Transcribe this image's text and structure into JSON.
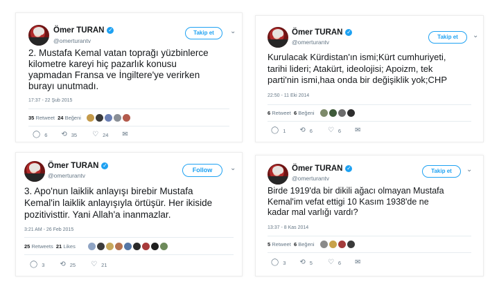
{
  "tweets": [
    {
      "name": "Ömer TURAN",
      "handle": "@omerturantv",
      "follow_label": "Takip et",
      "text_lines": [
        "2. Mustafa Kemal vatan toprağı yüzbinlerce",
        "kilometre kareyi hiç pazarlık konusu",
        "yapmadan Fransa ve İngiltere'ye verirken",
        "burayı unutmadı."
      ],
      "timestamp": "17:37 - 22 Şub 2015",
      "retweets_count": "35",
      "retweets_label": "Retweet",
      "likes_count": "24",
      "likes_label": "Beğeni",
      "replies": "6",
      "retweets_action": "35",
      "likes_action": "24"
    },
    {
      "name": "Ömer TURAN",
      "handle": "@omerturantv",
      "follow_label": "Takip et",
      "text_lines": [
        "Kurulacak Kürdistan'ın ismi;Kürt cumhuriyeti,",
        "tarihi lideri; Atakürt, ideolojisi; Apoizm, tek",
        "parti'nin ismi,haa onda bir değişiklik yok;CHP"
      ],
      "timestamp": "22:50 - 11 Eki 2014",
      "retweets_count": "6",
      "retweets_label": "Retweet",
      "likes_count": "6",
      "likes_label": "Beğeni",
      "replies": "1",
      "retweets_action": "6",
      "likes_action": "6"
    },
    {
      "name": "Ömer TURAN",
      "handle": "@omerturantv",
      "follow_label": "Follow",
      "text_lines": [
        "3. Apo'nun laiklik anlayışı birebir Mustafa",
        "Kemal'in laiklik anlayışıyla örtüşür. Her ikiside",
        "pozitivisttir. Yani Allah'a inanmazlar."
      ],
      "timestamp": "3:21 AM - 26 Feb 2015",
      "retweets_count": "25",
      "retweets_label": "Retweets",
      "likes_count": "21",
      "likes_label": "Likes",
      "replies": "3",
      "retweets_action": "25",
      "likes_action": "21"
    },
    {
      "name": "Ömer TURAN",
      "handle": "@omerturantv",
      "follow_label": "Takip et",
      "text_lines": [
        "Birde 1919'da bir dikili ağacı olmayan Mustafa",
        "Kemal'im vefat ettigi 10 Kasım 1938'de ne",
        "kadar mal varlığı vardı?"
      ],
      "timestamp": "13:37 - 8 Kas 2014",
      "retweets_count": "5",
      "retweets_label": "Retweet",
      "likes_count": "6",
      "likes_label": "Beğeni",
      "replies": "3",
      "retweets_action": "5",
      "likes_action": "6"
    }
  ],
  "icons": {
    "verified": "✓",
    "chevron": "⌄",
    "reply": "💬",
    "retweet": "⟲",
    "like": "♡",
    "dm": "✉"
  },
  "colors": {
    "accent": "#1da1f2",
    "meta": "#657786",
    "text": "#14171a"
  }
}
